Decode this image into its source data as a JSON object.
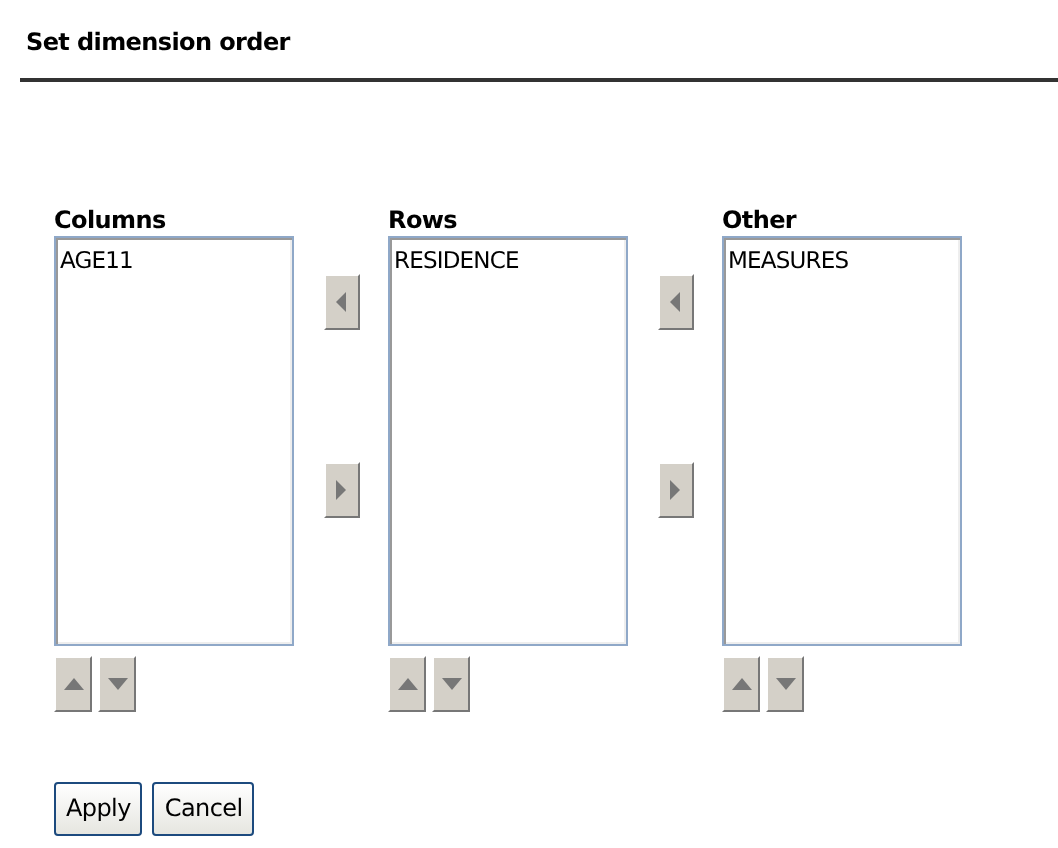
{
  "title": "Set dimension order",
  "lists": [
    {
      "label": "Columns",
      "items": [
        "AGE11"
      ]
    },
    {
      "label": "Rows",
      "items": [
        "RESIDENCE"
      ]
    },
    {
      "label": "Other",
      "items": [
        "MEASURES"
      ]
    }
  ],
  "buttons": [
    "Apply",
    "Cancel"
  ]
}
